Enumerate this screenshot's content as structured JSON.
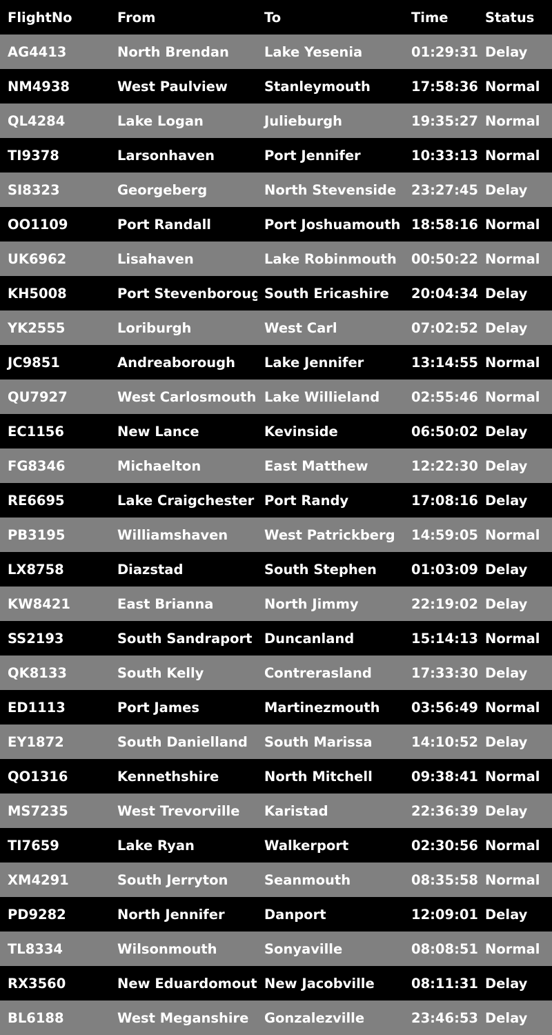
{
  "columns": [
    "FlightNo",
    "From",
    "To",
    "Time",
    "Status"
  ],
  "rows": [
    [
      "AG4413",
      "North Brendan",
      "Lake Yesenia",
      "01:29:31",
      "Delay"
    ],
    [
      "NM4938",
      "West Paulview",
      "Stanleymouth",
      "17:58:36",
      "Normal"
    ],
    [
      "QL4284",
      "Lake Logan",
      "Julieburgh",
      "19:35:27",
      "Normal"
    ],
    [
      "TI9378",
      "Larsonhaven",
      "Port Jennifer",
      "10:33:13",
      "Normal"
    ],
    [
      "SI8323",
      "Georgeberg",
      "North Stevenside",
      "23:27:45",
      "Delay"
    ],
    [
      "OO1109",
      "Port Randall",
      "Port Joshuamouth",
      "18:58:16",
      "Normal"
    ],
    [
      "UK6962",
      "Lisahaven",
      "Lake Robinmouth",
      "00:50:22",
      "Normal"
    ],
    [
      "KH5008",
      "Port Stevenborough",
      "South Ericashire",
      "20:04:34",
      "Delay"
    ],
    [
      "YK2555",
      "Loriburgh",
      "West Carl",
      "07:02:52",
      "Delay"
    ],
    [
      "JC9851",
      "Andreaborough",
      "Lake Jennifer",
      "13:14:55",
      "Normal"
    ],
    [
      "QU7927",
      "West Carlosmouth",
      "Lake Willieland",
      "02:55:46",
      "Normal"
    ],
    [
      "EC1156",
      "New Lance",
      "Kevinside",
      "06:50:02",
      "Delay"
    ],
    [
      "FG8346",
      "Michaelton",
      "East Matthew",
      "12:22:30",
      "Delay"
    ],
    [
      "RE6695",
      "Lake Craigchester",
      "Port Randy",
      "17:08:16",
      "Delay"
    ],
    [
      "PB3195",
      "Williamshaven",
      "West Patrickberg",
      "14:59:05",
      "Normal"
    ],
    [
      "LX8758",
      "Diazstad",
      "South Stephen",
      "01:03:09",
      "Delay"
    ],
    [
      "KW8421",
      "East Brianna",
      "North Jimmy",
      "22:19:02",
      "Delay"
    ],
    [
      "SS2193",
      "South Sandraport",
      "Duncanland",
      "15:14:13",
      "Normal"
    ],
    [
      "QK8133",
      "South Kelly",
      "Contrerasland",
      "17:33:30",
      "Delay"
    ],
    [
      "ED1113",
      "Port James",
      "Martinezmouth",
      "03:56:49",
      "Normal"
    ],
    [
      "EY1872",
      "South Danielland",
      "South Marissa",
      "14:10:52",
      "Delay"
    ],
    [
      "QO1316",
      "Kennethshire",
      "North Mitchell",
      "09:38:41",
      "Normal"
    ],
    [
      "MS7235",
      "West Trevorville",
      "Karistad",
      "22:36:39",
      "Delay"
    ],
    [
      "TI7659",
      "Lake Ryan",
      "Walkerport",
      "02:30:56",
      "Normal"
    ],
    [
      "XM4291",
      "South Jerryton",
      "Seanmouth",
      "08:35:58",
      "Normal"
    ],
    [
      "PD9282",
      "North Jennifer",
      "Danport",
      "12:09:01",
      "Delay"
    ],
    [
      "TL8334",
      "Wilsonmouth",
      "Sonyaville",
      "08:08:51",
      "Normal"
    ],
    [
      "RX3560",
      "New Eduardomouth",
      "New Jacobville",
      "08:11:31",
      "Delay"
    ],
    [
      "BL6188",
      "West Meganshire",
      "Gonzalezville",
      "23:46:53",
      "Delay"
    ]
  ],
  "colors": {
    "stripe": "#808080",
    "background": "#000000",
    "text": "#ffffff"
  }
}
